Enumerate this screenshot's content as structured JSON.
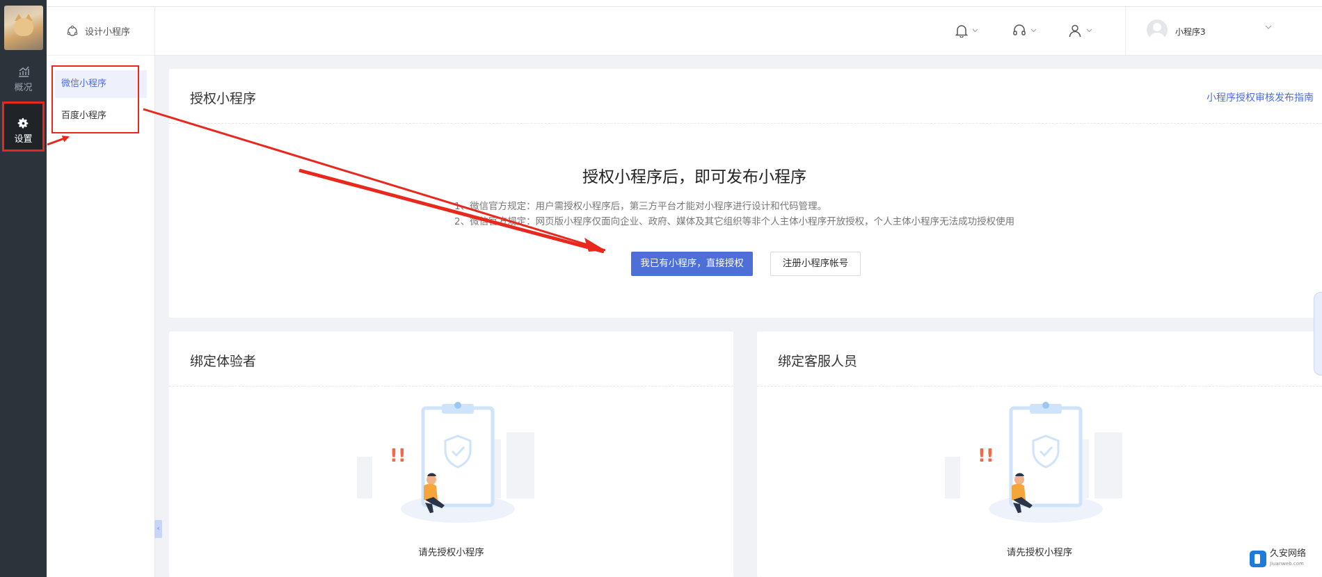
{
  "rail": {
    "overview_label": "概况",
    "settings_label": "设置"
  },
  "sidebar": {
    "header": "设计小程序",
    "items": [
      {
        "label": "微信小程序"
      },
      {
        "label": "百度小程序"
      }
    ]
  },
  "topbar": {
    "user_name": "小程序3"
  },
  "auth_card": {
    "title": "授权小程序",
    "guide_link": "小程序授权审核发布指南",
    "heading": "授权小程序后，即可发布小程序",
    "notes": [
      "1、微信官方规定：用户需授权小程序后，第三方平台才能对小程序进行设计和代码管理。",
      "2、微信官方规定：网页版小程序仅面向企业、政府、媒体及其它组织等非个人主体小程序开放授权，个人主体小程序无法成功授权使用"
    ],
    "primary_button": "我已有小程序，直接授权",
    "secondary_button": "注册小程序帐号"
  },
  "bind_experience": {
    "title": "绑定体验者",
    "empty_text": "请先授权小程序"
  },
  "bind_service": {
    "title": "绑定客服人员",
    "empty_text": "请先授权小程序"
  },
  "watermark": {
    "name": "久安网络",
    "sub": "Jiuanweb.com"
  },
  "colors": {
    "accent": "#4f6fd8",
    "annotation_red": "#e8281c",
    "rail": "#2c333b"
  }
}
